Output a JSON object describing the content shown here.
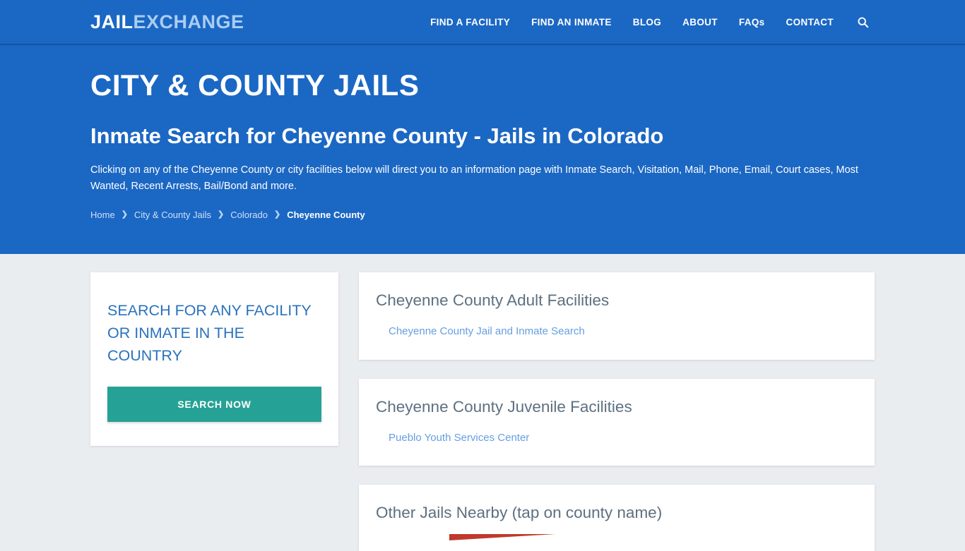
{
  "header": {
    "logo_primary": "JAIL",
    "logo_secondary": "EXCHANGE",
    "nav_items": [
      {
        "label": "FIND A FACILITY"
      },
      {
        "label": "FIND AN INMATE"
      },
      {
        "label": "BLOG"
      },
      {
        "label": "ABOUT"
      },
      {
        "label": "FAQs"
      },
      {
        "label": "CONTACT"
      }
    ],
    "search_icon": "search-icon",
    "background_color": "#1b67c4"
  },
  "hero": {
    "kicker": "CITY & COUNTY JAILS",
    "title": "Inmate Search for Cheyenne County - Jails in Colorado",
    "description": "Clicking on any of the Cheyenne County or city facilities below will direct you to an information page with Inmate Search, Visitation, Mail, Phone, Email, Court cases, Most Wanted, Recent Arrests, Bail/Bond and more.",
    "breadcrumb": [
      {
        "label": "Home",
        "current": false
      },
      {
        "label": "City & County Jails",
        "current": false
      },
      {
        "label": "Colorado",
        "current": false
      },
      {
        "label": "Cheyenne County",
        "current": true
      }
    ],
    "separator": "❯"
  },
  "sidebar": {
    "search_card": {
      "title": "SEARCH FOR ANY FACILITY OR INMATE IN THE COUNTRY",
      "button_label": "SEARCH NOW",
      "button_color": "#26a195",
      "title_color": "#2a72bd"
    }
  },
  "main": {
    "cards": [
      {
        "title": "Cheyenne County Adult Facilities",
        "links": [
          {
            "label": "Cheyenne County Jail and Inmate Search"
          }
        ]
      },
      {
        "title": "Cheyenne County Juvenile Facilities",
        "links": [
          {
            "label": "Pueblo Youth Services Center"
          }
        ]
      }
    ],
    "nearby_card": {
      "title": "Other Jails Nearby (tap on county name)",
      "map_color": "#c0392b"
    }
  }
}
